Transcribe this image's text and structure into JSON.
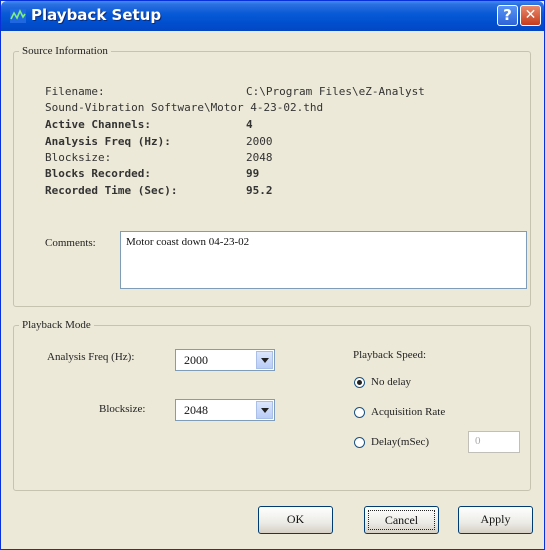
{
  "window": {
    "title": "Playback Setup",
    "help_label": "?",
    "close_label": "✕"
  },
  "source": {
    "legend": "Source Information",
    "filename_label": "Filename:",
    "filename_value": "C:\\Program Files\\eZ-Analyst",
    "filename_cont": "Sound-Vibration Software\\Motor 4-23-02.thd",
    "fields": [
      {
        "label": "Active Channels:",
        "value": "4"
      },
      {
        "label": "Analysis Freq (Hz):",
        "value": "2000"
      },
      {
        "label": "Blocksize:",
        "value": "2048"
      },
      {
        "label": "Blocks Recorded:",
        "value": "99"
      },
      {
        "label": "Recorded Time (Sec):",
        "value": "95.2"
      }
    ],
    "comments_label": "Comments:",
    "comments_value": "Motor coast down 04-23-02"
  },
  "mode": {
    "legend": "Playback Mode",
    "freq_label": "Analysis Freq (Hz):",
    "freq_value": "2000",
    "blocksize_label": "Blocksize:",
    "blocksize_value": "2048",
    "speed_label": "Playback Speed:",
    "options": [
      {
        "label": "No delay",
        "selected": true
      },
      {
        "label": "Acquisition Rate",
        "selected": false
      },
      {
        "label": "Delay(mSec)",
        "selected": false
      }
    ],
    "delay_value": "0"
  },
  "buttons": {
    "ok": "OK",
    "cancel": "Cancel",
    "apply": "Apply"
  }
}
